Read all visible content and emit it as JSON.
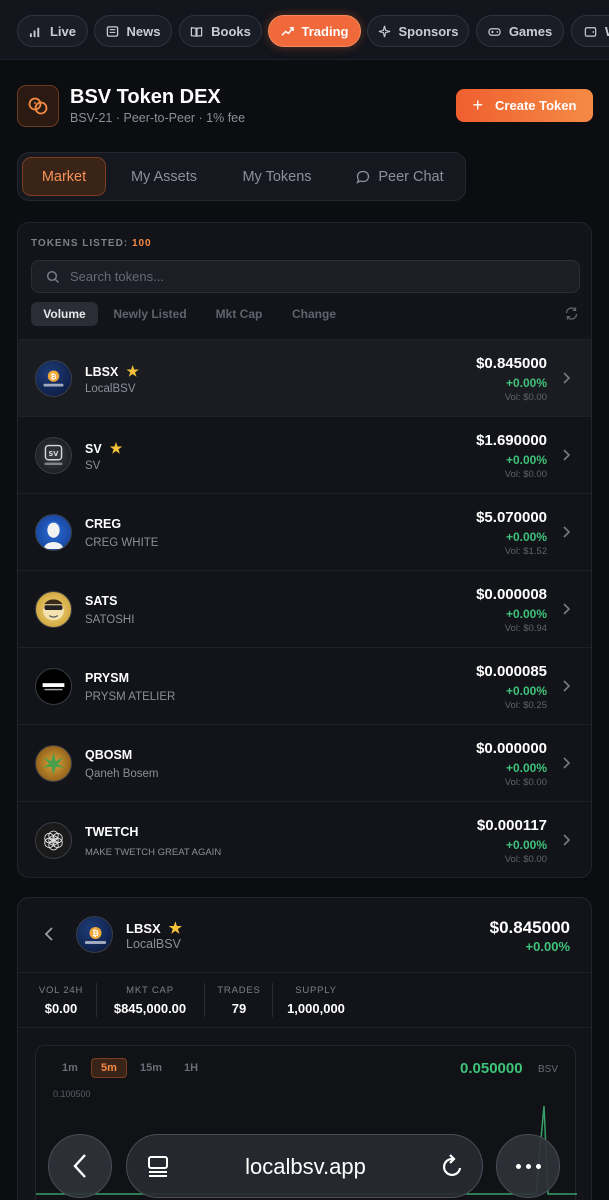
{
  "nav": {
    "items": [
      {
        "label": "Live",
        "icon": "signal-bars-icon"
      },
      {
        "label": "News",
        "icon": "newspaper-icon"
      },
      {
        "label": "Books",
        "icon": "book-icon"
      },
      {
        "label": "Trading",
        "icon": "trend-up-icon",
        "active": true
      },
      {
        "label": "Sponsors",
        "icon": "sparkle-icon"
      },
      {
        "label": "Games",
        "icon": "gamepad-icon"
      },
      {
        "label": "W",
        "icon": "wallet-icon"
      }
    ]
  },
  "header": {
    "title": "BSV Token DEX",
    "subtitle": "BSV-21 · Peer-to-Peer · 1% fee",
    "create_label": "Create Token",
    "accent": "#f0693a"
  },
  "tabs": [
    {
      "label": "Market",
      "active": true
    },
    {
      "label": "My Assets"
    },
    {
      "label": "My Tokens"
    },
    {
      "label": "Peer Chat",
      "icon": "chat-bubble-icon"
    }
  ],
  "market": {
    "listed_label": "TOKENS LISTED:",
    "listed_count": "100",
    "search_placeholder": "Search tokens...",
    "sorts": [
      {
        "label": "Volume",
        "active": true
      },
      {
        "label": "Newly Listed"
      },
      {
        "label": "Mkt Cap"
      },
      {
        "label": "Change"
      }
    ],
    "tokens": [
      {
        "symbol": "LBSX",
        "name": "LocalBSV",
        "price": "$0.845000",
        "change": "+0.00%",
        "volume": "Vol: $0.00",
        "starred": true
      },
      {
        "symbol": "SV",
        "name": "SV",
        "price": "$1.690000",
        "change": "+0.00%",
        "volume": "Vol: $0.00",
        "starred": true
      },
      {
        "symbol": "CREG",
        "name": "CREG WHITE",
        "price": "$5.070000",
        "change": "+0.00%",
        "volume": "Vol: $1.52",
        "starred": false
      },
      {
        "symbol": "SATS",
        "name": "SATOSHI",
        "price": "$0.000008",
        "change": "+0.00%",
        "volume": "Vol: $0.94",
        "starred": false
      },
      {
        "symbol": "PRYSM",
        "name": "PRYSM ATELIER",
        "price": "$0.000085",
        "change": "+0.00%",
        "volume": "Vol: $0.25",
        "starred": false
      },
      {
        "symbol": "QBOSM",
        "name": "Qaneh Bosem",
        "price": "$0.000000",
        "change": "+0.00%",
        "volume": "Vol: $0.00",
        "starred": false
      },
      {
        "symbol": "TWETCH",
        "name": "MAKE TWETCH GREAT AGAIN",
        "price": "$0.000117",
        "change": "+0.00%",
        "volume": "Vol: $0.00",
        "starred": false
      }
    ],
    "up_color": "#3fc27a"
  },
  "detail": {
    "symbol": "LBSX",
    "name": "LocalBSV",
    "price": "$0.845000",
    "change": "+0.00%",
    "stats": [
      {
        "label": "VOL 24H",
        "value": "$0.00"
      },
      {
        "label": "MKT CAP",
        "value": "$845,000.00"
      },
      {
        "label": "TRADES",
        "value": "79"
      },
      {
        "label": "SUPPLY",
        "value": "1,000,000"
      }
    ],
    "chart": {
      "timeframes": [
        {
          "label": "1m"
        },
        {
          "label": "5m",
          "active": true
        },
        {
          "label": "15m"
        },
        {
          "label": "1H"
        }
      ],
      "current_value": "0.050000",
      "current_unit": "BSV",
      "y_tick": "0.100500"
    }
  },
  "browser": {
    "url": "localbsv.app"
  }
}
